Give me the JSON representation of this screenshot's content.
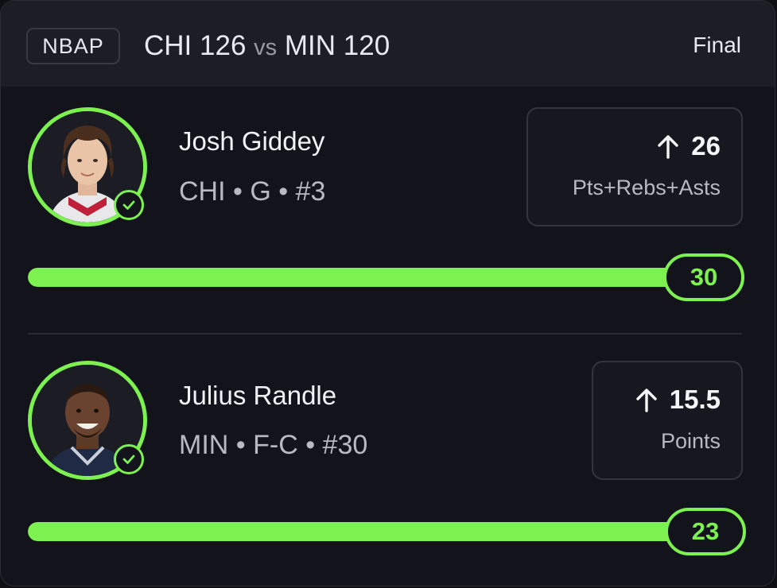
{
  "header": {
    "league": "NBAP",
    "home_team": "CHI",
    "home_score": "126",
    "vs": "vs",
    "away_team": "MIN",
    "away_score": "120",
    "status": "Final"
  },
  "players": [
    {
      "name": "Josh Giddey",
      "meta": "CHI • G • #3",
      "line": "26",
      "stat": "Pts+Rebs+Asts",
      "direction": "over",
      "result": "30",
      "progress_percent": 100,
      "hit": true
    },
    {
      "name": "Julius Randle",
      "meta": "MIN • F-C • #30",
      "line": "15.5",
      "stat": "Points",
      "direction": "over",
      "result": "23",
      "progress_percent": 100,
      "hit": true
    }
  ],
  "colors": {
    "accent": "#7cf14f",
    "background": "#13131b",
    "header_bg": "#1d1d25"
  }
}
